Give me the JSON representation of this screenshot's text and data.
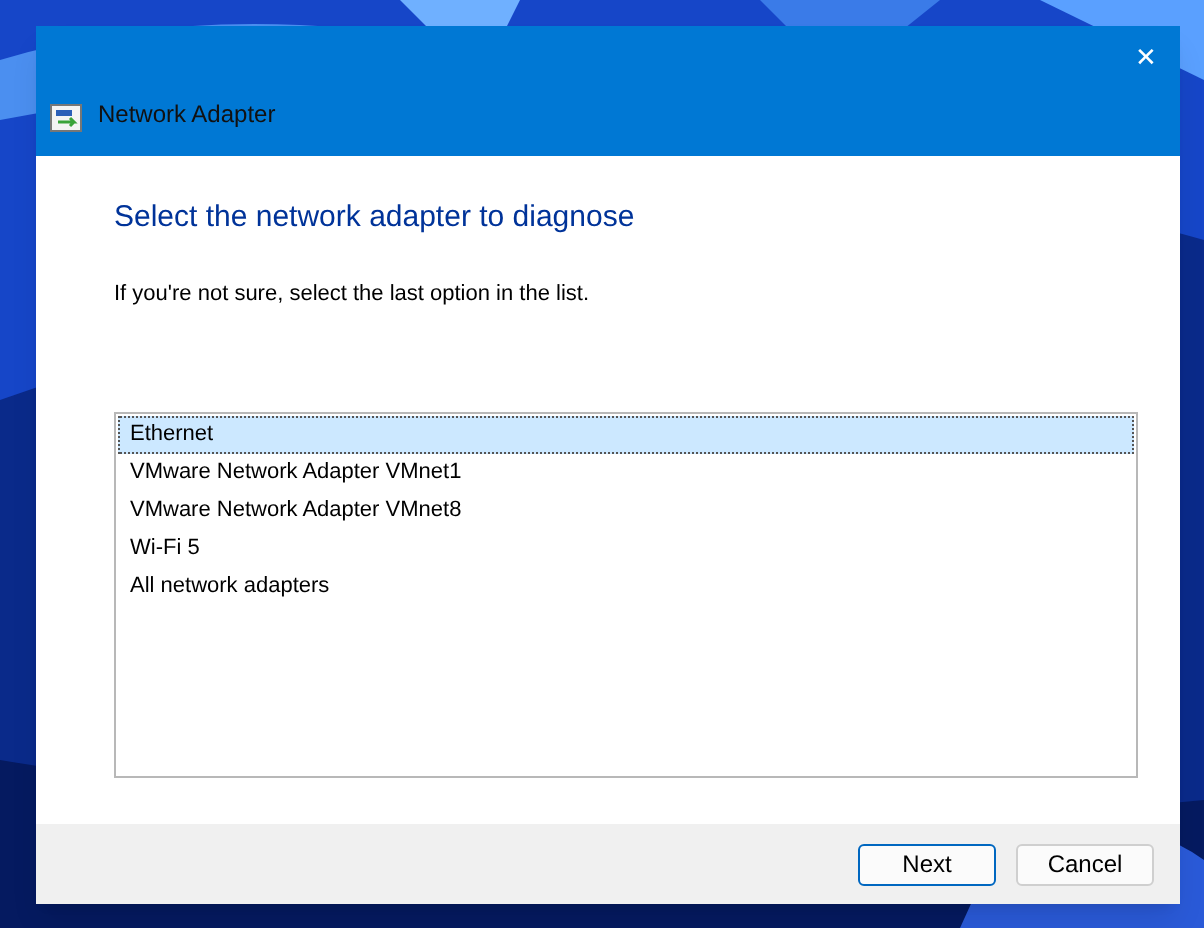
{
  "window": {
    "title": "Network Adapter",
    "close": "✕"
  },
  "heading": "Select the network adapter to diagnose",
  "instruction": "If you're not sure, select the last option in the list.",
  "adapters": [
    {
      "label": "Ethernet",
      "selected": true
    },
    {
      "label": "VMware Network Adapter VMnet1",
      "selected": false
    },
    {
      "label": "VMware Network Adapter VMnet8",
      "selected": false
    },
    {
      "label": "Wi-Fi 5",
      "selected": false
    },
    {
      "label": "All network adapters",
      "selected": false
    }
  ],
  "buttons": [
    {
      "label": "Next",
      "default": true
    },
    {
      "label": "Cancel",
      "default": false
    }
  ]
}
